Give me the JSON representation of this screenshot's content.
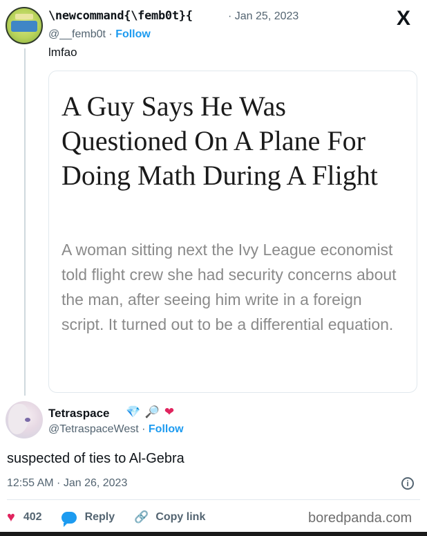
{
  "tweet1": {
    "author_name": "\\newcommand{\\femb0t}{",
    "date": "· Jan 25, 2023",
    "handle": "@__femb0t",
    "follow_label": "Follow",
    "text": "lmfao",
    "logo": "X"
  },
  "article_card": {
    "headline": "A Guy Says He Was Questioned On A Plane For Doing Math During A Flight",
    "subtext": "A woman sitting next the Ivy League economist told flight crew she had security concerns about the man, after seeing him write in a foreign script. It turned out to be a differential equation."
  },
  "tweet2": {
    "author_name": "Tetraspace",
    "emojis": [
      "💎",
      "🔎",
      "❤"
    ],
    "handle": "@TetraspaceWest",
    "follow_label": "Follow",
    "text": "suspected of ties to Al-Gebra",
    "timestamp": "12:55 AM · Jan 26, 2023"
  },
  "actions": {
    "likes": "402",
    "reply_label": "Reply",
    "copy_link_label": "Copy link"
  },
  "watermark": "boredpanda.com",
  "colors": {
    "accent": "#1d9bf0",
    "heart": "#e0245e",
    "muted": "#536471"
  }
}
